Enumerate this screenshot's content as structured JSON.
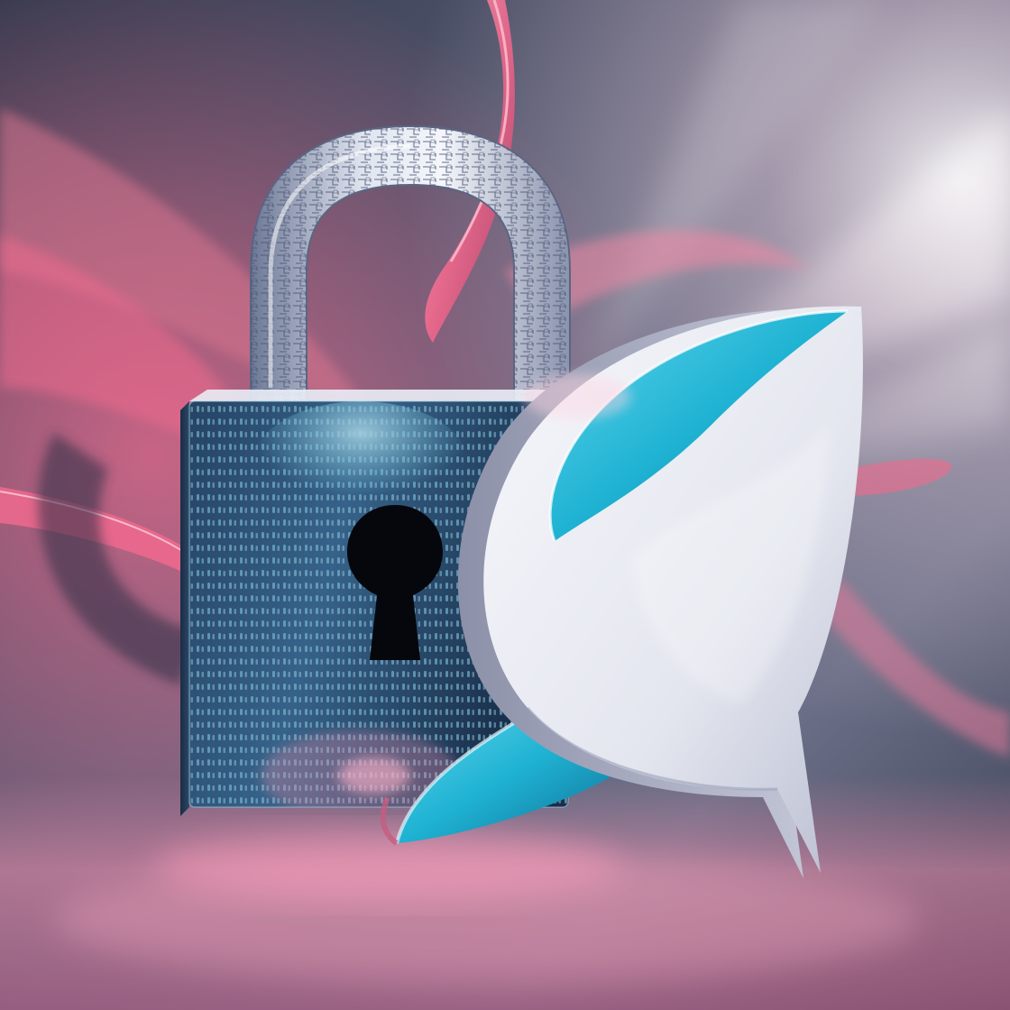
{
  "scene": {
    "colors": {
      "background_dark": "#343a4e",
      "background_mid": "#6a6e86",
      "light_ray": "#f2d6e2",
      "ribbon_pink": "#f06a8e",
      "ribbon_deep": "#c2466e",
      "lock_body_dark": "#1e3552",
      "lock_body_light": "#3c6a93",
      "code_glow": "#79d4f2",
      "shackle_light": "#e4e8f2",
      "shackle_dark": "#6d7896",
      "keyhole": "#05070d",
      "bubble_white": "#eef0f6",
      "bubble_shadow": "#b9bdd0",
      "bubble_cyan": "#1fb2d2",
      "bubble_cyan_dark": "#0f6f98",
      "floor_pink": "#e88aa8"
    },
    "icons": [
      "padlock-icon",
      "speech-bubble-icon",
      "keyhole-icon"
    ]
  }
}
